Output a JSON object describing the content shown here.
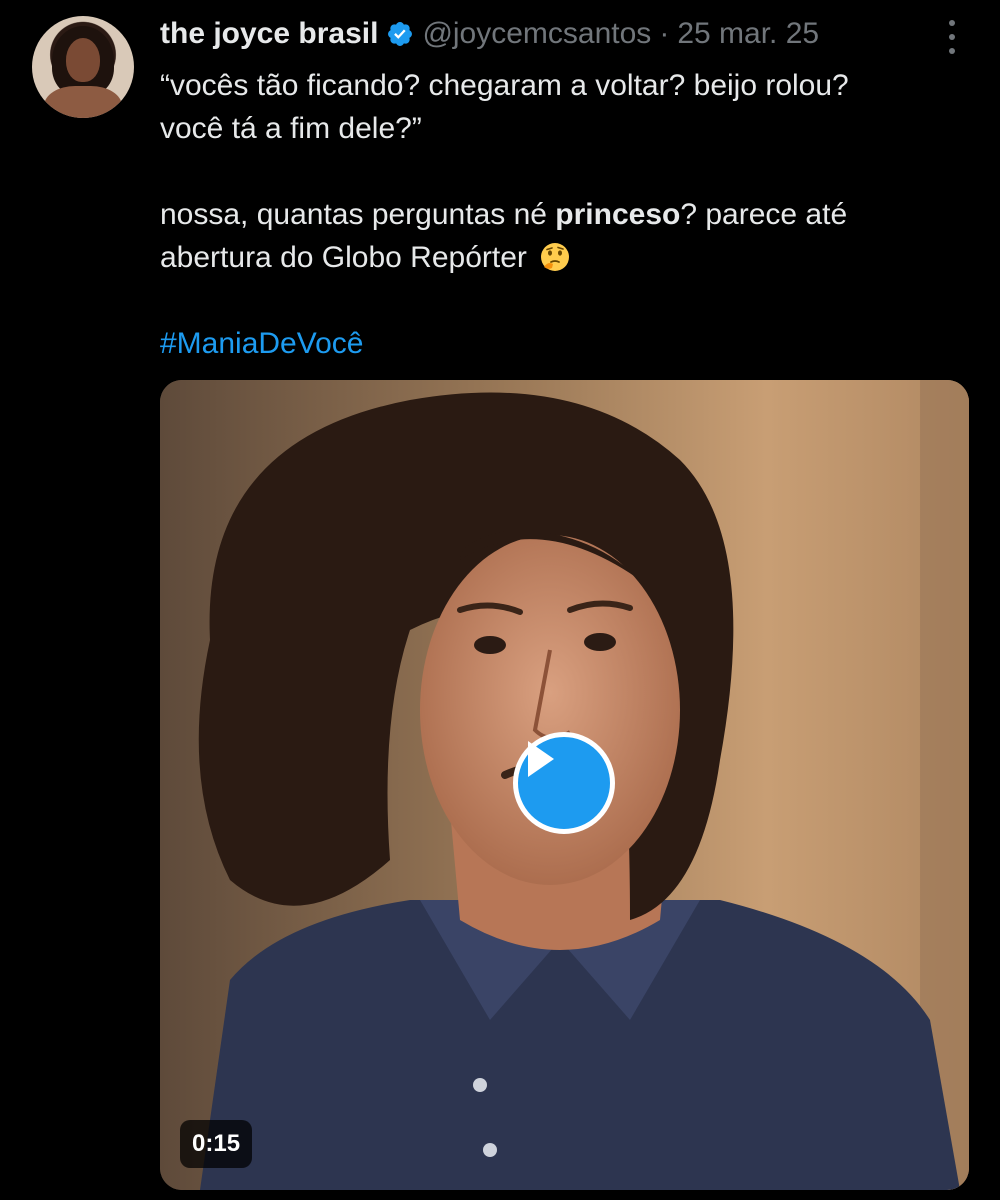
{
  "tweet": {
    "display_name": "the joyce brasil",
    "verified_icon": "verified-badge-icon",
    "handle": "@joycemcsantos",
    "separator": "·",
    "date": "25 mar. 25",
    "line1": "“vocês tão ficando? chegaram a voltar? beijo rolou?",
    "line2": "você tá a fim dele?”",
    "line3_start": "nossa, quantas perguntas né ",
    "line3_bold": "princeso",
    "line3_end": "? parece até",
    "line4": "abertura do Globo Repórter",
    "emoji": "thinking-face-emoji",
    "hashtag": "#ManiaDeVocê"
  },
  "media": {
    "type": "video",
    "play_icon": "play-icon",
    "duration": "0:15"
  },
  "colors": {
    "background": "#000000",
    "text": "#e7e9ea",
    "muted": "#71767b",
    "accent": "#1d9bf0"
  }
}
